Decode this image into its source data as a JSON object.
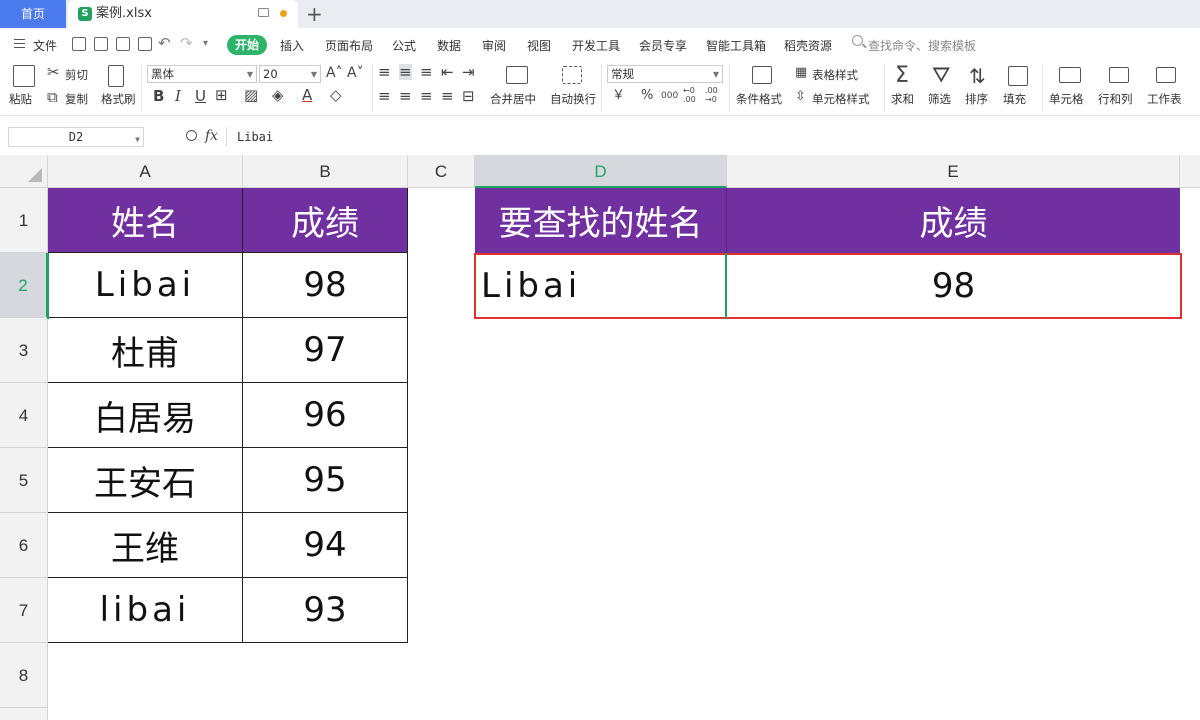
{
  "tabs": {
    "home": "首页",
    "file": "案例.xlsx",
    "file_icon": "S"
  },
  "menu": {
    "file": "文件",
    "items": [
      "开始",
      "插入",
      "页面布局",
      "公式",
      "数据",
      "审阅",
      "视图",
      "开发工具",
      "会员专享",
      "智能工具箱",
      "稻壳资源"
    ],
    "search_placeholder": "查找命令、搜索模板"
  },
  "ribbon": {
    "paste": "粘贴",
    "cut": "剪切",
    "copy": "复制",
    "format_painter": "格式刷",
    "font_name": "黑体",
    "font_size": "20",
    "merge_center": "合并居中",
    "wrap_text": "自动换行",
    "number_format": "常规",
    "conditional_format": "条件格式",
    "table_style": "表格样式",
    "cell_style": "单元格样式",
    "sum": "求和",
    "filter": "筛选",
    "sort": "排序",
    "fill": "填充",
    "cell": "单元格",
    "row_col": "行和列",
    "worksheet": "工作表",
    "currency_symbol": "￥",
    "percent_symbol": "%",
    "thousands_symbol": "000",
    "increase_decimal": "←0 .00",
    "decrease_decimal": ".00 →0"
  },
  "formula_bar": {
    "cell_ref": "D2",
    "fx": "fx",
    "content": "Libai"
  },
  "columns": [
    "A",
    "B",
    "C",
    "D",
    "E"
  ],
  "rows": [
    "1",
    "2",
    "3",
    "4",
    "5",
    "6",
    "7",
    "8"
  ],
  "table": {
    "headers": [
      "姓名",
      "成绩"
    ],
    "rows": [
      [
        "Libai",
        "98"
      ],
      [
        "杜甫",
        "97"
      ],
      [
        "白居易",
        "96"
      ],
      [
        "王安石",
        "95"
      ],
      [
        "王维",
        "94"
      ],
      [
        "libai",
        "93"
      ]
    ]
  },
  "lookup": {
    "headers": [
      "要查找的姓名",
      "成绩"
    ],
    "name": "Libai",
    "score": "98"
  },
  "colors": {
    "header_fill": "#7030a0",
    "selection": "#1fa362",
    "highlight_border": "#e03030",
    "tab_active": "#4b7bec",
    "start_button": "#2db46a"
  }
}
